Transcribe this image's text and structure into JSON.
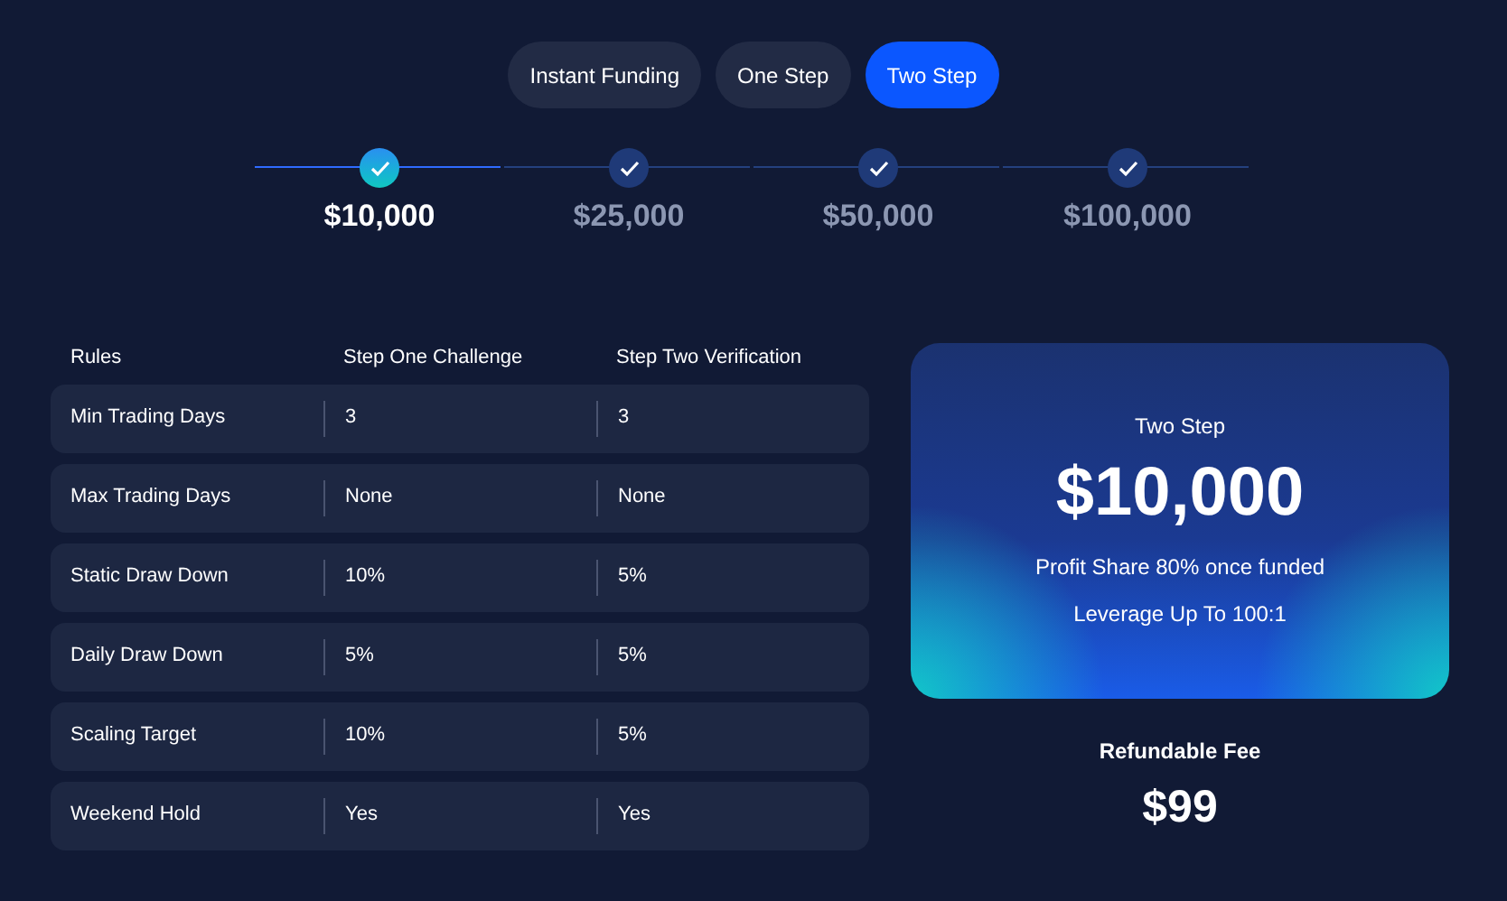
{
  "plan_tabs": [
    {
      "label": "Instant Funding",
      "selected": false
    },
    {
      "label": "One Step",
      "selected": false
    },
    {
      "label": "Two Step",
      "selected": true
    }
  ],
  "account_sizes": [
    {
      "label": "$10,000",
      "selected": true
    },
    {
      "label": "$25,000",
      "selected": false
    },
    {
      "label": "$50,000",
      "selected": false
    },
    {
      "label": "$100,000",
      "selected": false
    }
  ],
  "rules_table": {
    "columns": [
      "Rules",
      "Step One Challenge",
      "Step Two Verification"
    ],
    "rows": [
      [
        "Min Trading Days",
        "3",
        "3"
      ],
      [
        "Max Trading Days",
        "None",
        "None"
      ],
      [
        "Static Draw Down",
        "10%",
        "5%"
      ],
      [
        "Daily Draw Down",
        "5%",
        "5%"
      ],
      [
        "Scaling Target",
        "10%",
        "5%"
      ],
      [
        "Weekend Hold",
        "Yes",
        "Yes"
      ]
    ]
  },
  "summary_card": {
    "plan": "Two Step",
    "amount": "$10,000",
    "lines": [
      "Profit Share 80% once funded",
      "Leverage Up To 100:1"
    ]
  },
  "fee": {
    "label": "Refundable Fee",
    "amount": "$99"
  }
}
